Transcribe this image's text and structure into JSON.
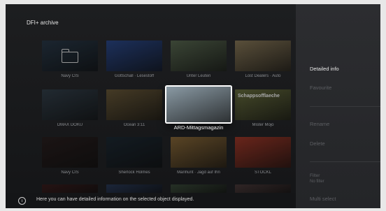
{
  "app": {
    "title": "DFI+ archive"
  },
  "grid": {
    "rows": [
      [
        {
          "label": "Navy CIS",
          "bg": "#2a3a4a"
        },
        {
          "label": "Gottschall · Lesestoff",
          "bg": "#2c4a8c"
        },
        {
          "label": "Unter Leuten",
          "bg": "#5a6a52"
        },
        {
          "label": "Lost Dealers · Auto",
          "bg": "#8a7a5a"
        }
      ],
      [
        {
          "label": "DMAX DOKU",
          "bg": "#34414c"
        },
        {
          "label": "Ocean 3:11",
          "bg": "#6a5a3a"
        },
        {
          "label": "ARD-Mittagsmagazin",
          "bg": "#8a9aa4",
          "selected": true
        },
        {
          "label": "Mister Mojo",
          "bg": "#6a7040",
          "badge": "Schappsofflaeche"
        }
      ],
      [
        {
          "label": "Navy CIS",
          "bg": "#2a2020"
        },
        {
          "label": "Sherlock Holmes",
          "bg": "#1e2a34"
        },
        {
          "label": "Manhunt · Jagd auf Ihn",
          "bg": "#8a6a3a"
        },
        {
          "label": "STOCKL",
          "bg": "#a23a2a"
        }
      ],
      [
        {
          "label": "",
          "bg": "#3a1e1e"
        },
        {
          "label": "",
          "bg": "#2a3a58"
        },
        {
          "label": "",
          "bg": "#3a4a3a"
        },
        {
          "label": "",
          "bg": "#4a3a3a"
        }
      ]
    ]
  },
  "menu": {
    "items": [
      {
        "label": "Detailed info",
        "active": true
      },
      {
        "label": "Favourite",
        "active": false
      },
      {
        "label": "Rename",
        "active": false
      },
      {
        "label": "Delete",
        "active": false
      },
      {
        "label": "Filter",
        "active": false
      },
      {
        "label": "No filter",
        "active": false
      },
      {
        "label": "Multi select",
        "active": false
      }
    ]
  },
  "info": {
    "icon": "info-icon",
    "text": "Here you can have detailed information on the selected object displayed."
  }
}
